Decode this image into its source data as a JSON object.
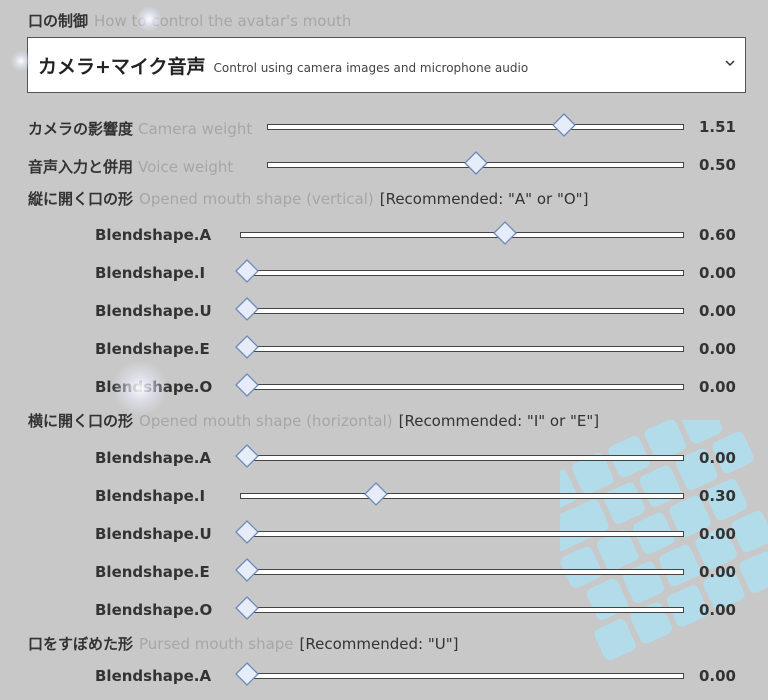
{
  "mouth_control": {
    "title": "口の制御",
    "title_en": "How to control the avatar's mouth",
    "dropdown": {
      "selected": "カメラ+マイク音声",
      "selected_sub": "Control using camera images and microphone audio"
    }
  },
  "weights": [
    {
      "label": "カメラの影響度",
      "label_en": "Camera weight",
      "value": "1.51",
      "fraction": 0.72
    },
    {
      "label": "音声入力と併用",
      "label_en": "Voice weight",
      "value": "0.50",
      "fraction": 0.5
    }
  ],
  "vertical": {
    "title": "縦に開く口の形",
    "title_en": "Opened mouth shape (vertical)",
    "recommend": "[Recommended: \"A\" or \"O\"]",
    "sliders": [
      {
        "label": "Blendshape.A",
        "value": "0.60",
        "fraction": 0.6
      },
      {
        "label": "Blendshape.I",
        "value": "0.00",
        "fraction": 0.0
      },
      {
        "label": "Blendshape.U",
        "value": "0.00",
        "fraction": 0.0
      },
      {
        "label": "Blendshape.E",
        "value": "0.00",
        "fraction": 0.0
      },
      {
        "label": "Blendshape.O",
        "value": "0.00",
        "fraction": 0.0
      }
    ]
  },
  "horizontal": {
    "title": "横に開く口の形",
    "title_en": "Opened mouth shape (horizontal)",
    "recommend": "[Recommended: \"I\" or \"E\"]",
    "sliders": [
      {
        "label": "Blendshape.A",
        "value": "0.00",
        "fraction": 0.0
      },
      {
        "label": "Blendshape.I",
        "value": "0.30",
        "fraction": 0.3
      },
      {
        "label": "Blendshape.U",
        "value": "0.00",
        "fraction": 0.0
      },
      {
        "label": "Blendshape.E",
        "value": "0.00",
        "fraction": 0.0
      },
      {
        "label": "Blendshape.O",
        "value": "0.00",
        "fraction": 0.0
      }
    ]
  },
  "pursed": {
    "title": "口をすぼめた形",
    "title_en": "Pursed mouth shape",
    "recommend": "[Recommended: \"U\"]",
    "sliders": [
      {
        "label": "Blendshape.A",
        "value": "0.00",
        "fraction": 0.0
      }
    ]
  },
  "colors": {
    "thumb_fill": "#e6ecfa",
    "thumb_stroke": "#6d89b8",
    "accent": "#a6a6a6"
  }
}
